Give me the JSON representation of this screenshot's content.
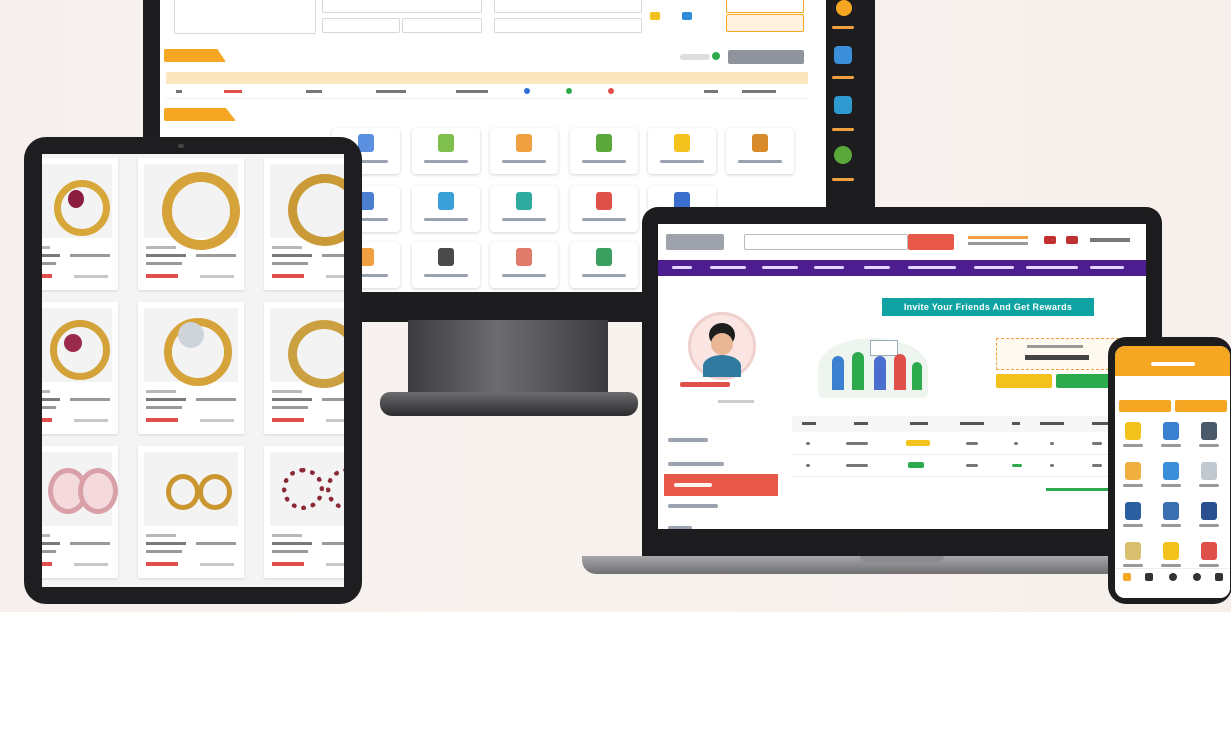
{
  "colors": {
    "accent_orange": "#f5a623",
    "nav_purple": "#4b1d8f",
    "banner_teal": "#0fa3a3",
    "active_red": "#e8584a",
    "green": "#2eaa4e",
    "yellow": "#f3c21c",
    "price_red": "#e0504a"
  },
  "laptop": {
    "banner_text": "Invite Your Friends And Get Rewards"
  },
  "icons": [
    "monitor-icon",
    "tablet-icon",
    "laptop-icon",
    "phone-icon",
    "ring-icon",
    "avatar-icon"
  ]
}
